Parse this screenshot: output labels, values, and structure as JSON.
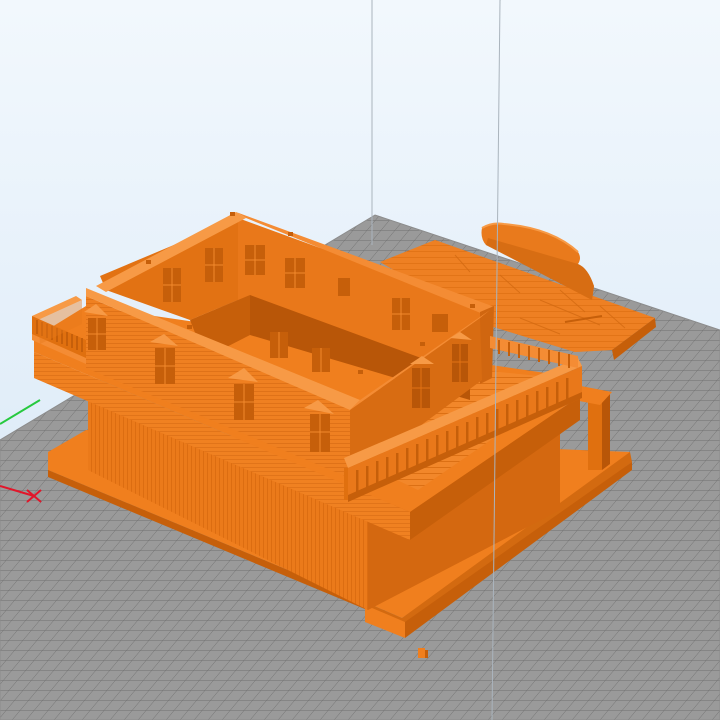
{
  "viewport": {
    "background_top": "#f2f8fd",
    "background_bottom": "#cfe2f4"
  },
  "build_plate": {
    "tile_color": "#9a9a9a",
    "grid_line_color": "#6f6f6f"
  },
  "model": {
    "color": "#f07f1e",
    "shadow_color": "#c65f0a",
    "highlight_color": "#f79a46"
  },
  "axes": {
    "x_color": "#e2162a",
    "y_color": "#27c93f",
    "x_marker": "x-marker-icon"
  },
  "bounding_box": {
    "color": "#aab4bd"
  }
}
